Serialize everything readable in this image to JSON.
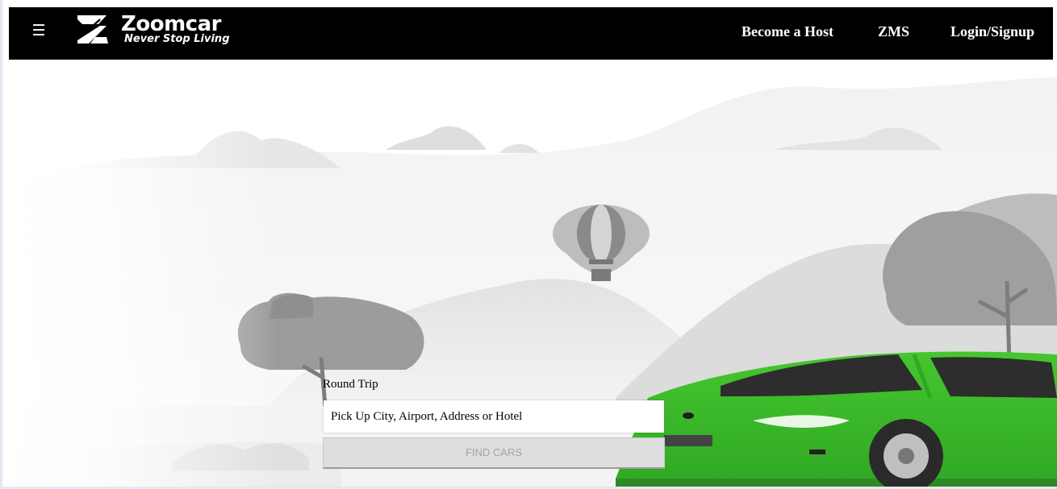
{
  "brand": {
    "name": "Zoomcar",
    "tagline": "Never Stop Living"
  },
  "nav": {
    "menu_icon": "hamburger-menu-icon",
    "links": [
      "Become a Host",
      "ZMS",
      "Login/Signup"
    ]
  },
  "search": {
    "trip_type_label": "Round Trip",
    "pickup_placeholder": "Pick Up City, Airport, Address or Hotel",
    "find_button_label": "FIND CARS"
  },
  "colors": {
    "navbar": "#000000",
    "car_green": "#3cb92a",
    "button_bg": "#dedede"
  }
}
